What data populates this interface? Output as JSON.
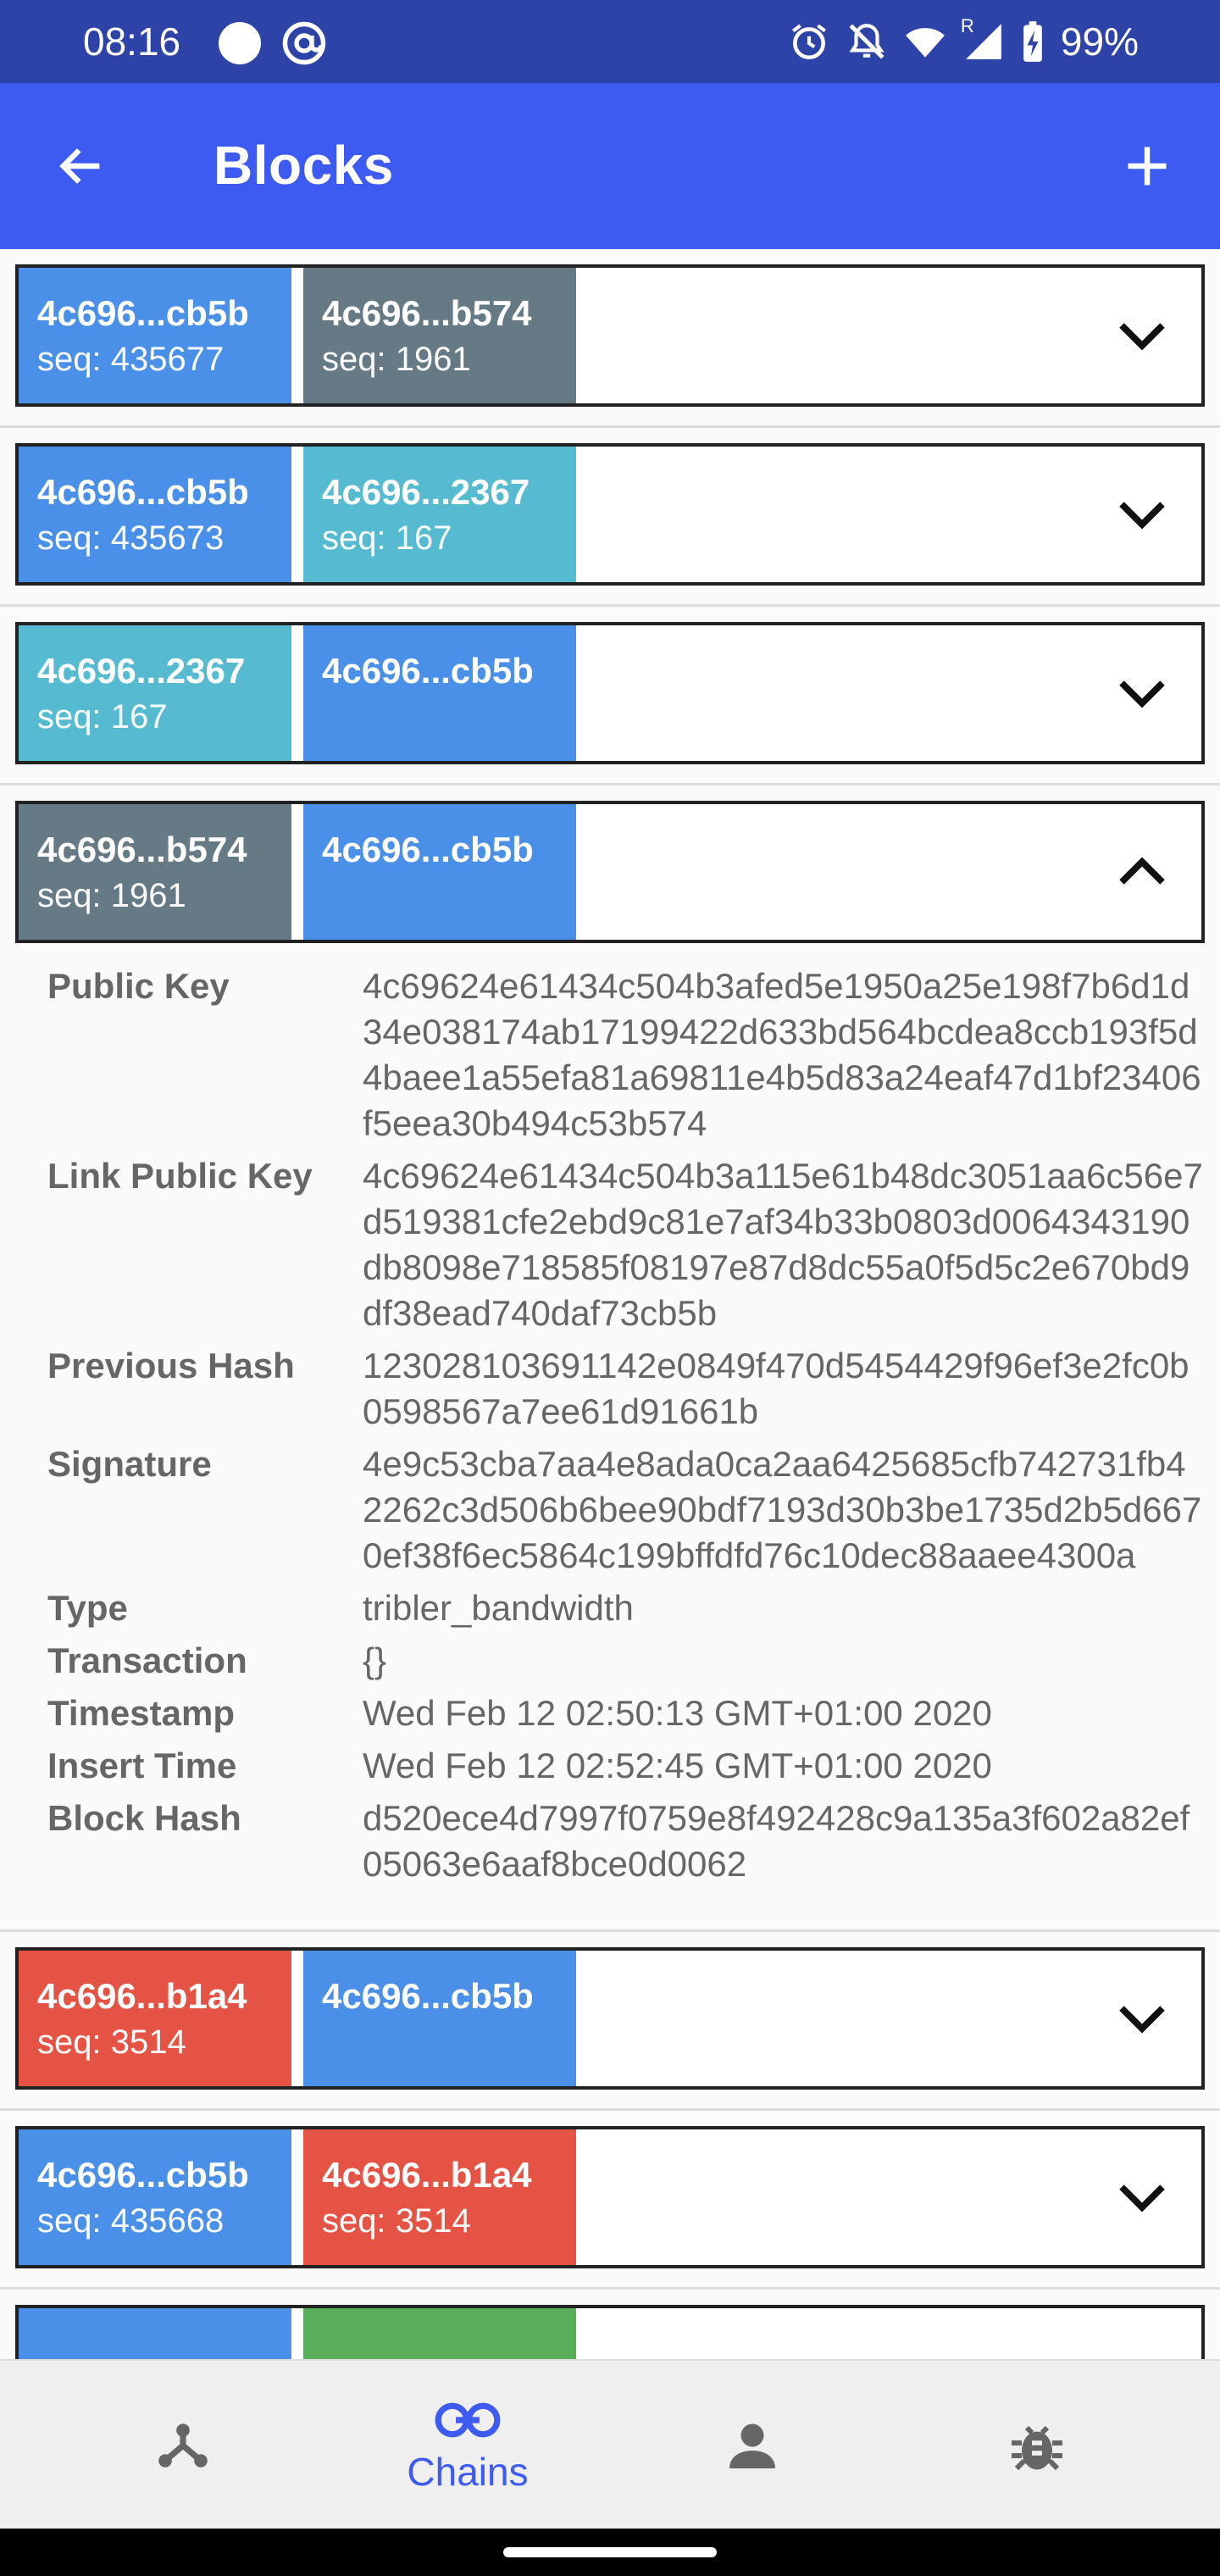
{
  "status_bar": {
    "time": "08:16",
    "battery": "99%",
    "network_badge": "R"
  },
  "app_bar": {
    "title": "Blocks",
    "back_icon": "arrow-back-icon",
    "add_icon": "plus-icon"
  },
  "colors": {
    "blue": "#4a90e8",
    "slate": "#667a86",
    "teal": "#56bbd1",
    "red": "#e55344",
    "green": "#5aad5a",
    "primary": "#3d5af1"
  },
  "blocks": [
    {
      "a": {
        "hash": "4c696...cb5b",
        "seq": "seq: 435677",
        "color": "#4a90e8"
      },
      "b": {
        "hash": "4c696...b574",
        "seq": "seq: 1961",
        "color": "#667a86"
      },
      "expanded": false
    },
    {
      "a": {
        "hash": "4c696...cb5b",
        "seq": "seq: 435673",
        "color": "#4a90e8"
      },
      "b": {
        "hash": "4c696...2367",
        "seq": "seq: 167",
        "color": "#56bbd1"
      },
      "expanded": false
    },
    {
      "a": {
        "hash": "4c696...2367",
        "seq": "seq: 167",
        "color": "#56bbd1"
      },
      "b": {
        "hash": "4c696...cb5b",
        "seq": "",
        "color": "#4a90e8"
      },
      "expanded": false
    },
    {
      "a": {
        "hash": "4c696...b574",
        "seq": "seq: 1961",
        "color": "#667a86"
      },
      "b": {
        "hash": "4c696...cb5b",
        "seq": "",
        "color": "#4a90e8"
      },
      "expanded": true
    },
    {
      "a": {
        "hash": "4c696...b1a4",
        "seq": "seq: 3514",
        "color": "#e55344"
      },
      "b": {
        "hash": "4c696...cb5b",
        "seq": "",
        "color": "#4a90e8"
      },
      "expanded": false
    },
    {
      "a": {
        "hash": "4c696...cb5b",
        "seq": "seq: 435668",
        "color": "#4a90e8"
      },
      "b": {
        "hash": "4c696...b1a4",
        "seq": "seq: 3514",
        "color": "#e55344"
      },
      "expanded": false
    },
    {
      "a": {
        "hash": "",
        "seq": "",
        "color": "#4a90e8"
      },
      "b": {
        "hash": "",
        "seq": "",
        "color": "#5aad5a"
      },
      "expanded": false
    }
  ],
  "details": [
    {
      "label": "Public Key",
      "value": "4c69624e61434c504b3afed5e1950a25e198f7b6d1d34e038174ab17199422d633bd564bcdea8ccb193f5d4baee1a55efa81a69811e4b5d83a24eaf47d1bf23406f5eea30b494c53b574"
    },
    {
      "label": "Link Public Key",
      "value": "4c69624e61434c504b3a115e61b48dc3051aa6c56e7d519381cfe2ebd9c81e7af34b33b0803d0064343190db8098e718585f08197e87d8dc55a0f5d5c2e670bd9df38ead740daf73cb5b"
    },
    {
      "label": "Previous Hash",
      "value": "123028103691142e0849f470d5454429f96ef3e2fc0b0598567a7ee61d91661b"
    },
    {
      "label": "Signature",
      "value": "4e9c53cba7aa4e8ada0ca2aa6425685cfb742731fb42262c3d506b6bee90bdf7193d30b3be1735d2b5d6670ef38f6ec5864c199bffdfd76c10dec88aaee4300a"
    },
    {
      "label": "Type",
      "value": "tribler_bandwidth"
    },
    {
      "label": "Transaction",
      "value": "{}"
    },
    {
      "label": "Timestamp",
      "value": "Wed Feb 12 02:50:13 GMT+01:00 2020"
    },
    {
      "label": "Insert Time",
      "value": "Wed Feb 12 02:52:45 GMT+01:00 2020"
    },
    {
      "label": "Block Hash",
      "value": "d520ece4d7997f0759e8f492428c9a135a3f602a82ef05063e6aaf8bce0d0062"
    }
  ],
  "bottom_nav": [
    {
      "icon": "network-icon",
      "label": ""
    },
    {
      "icon": "link-icon",
      "label": "Chains",
      "active": true
    },
    {
      "icon": "person-icon",
      "label": ""
    },
    {
      "icon": "bug-icon",
      "label": ""
    }
  ]
}
